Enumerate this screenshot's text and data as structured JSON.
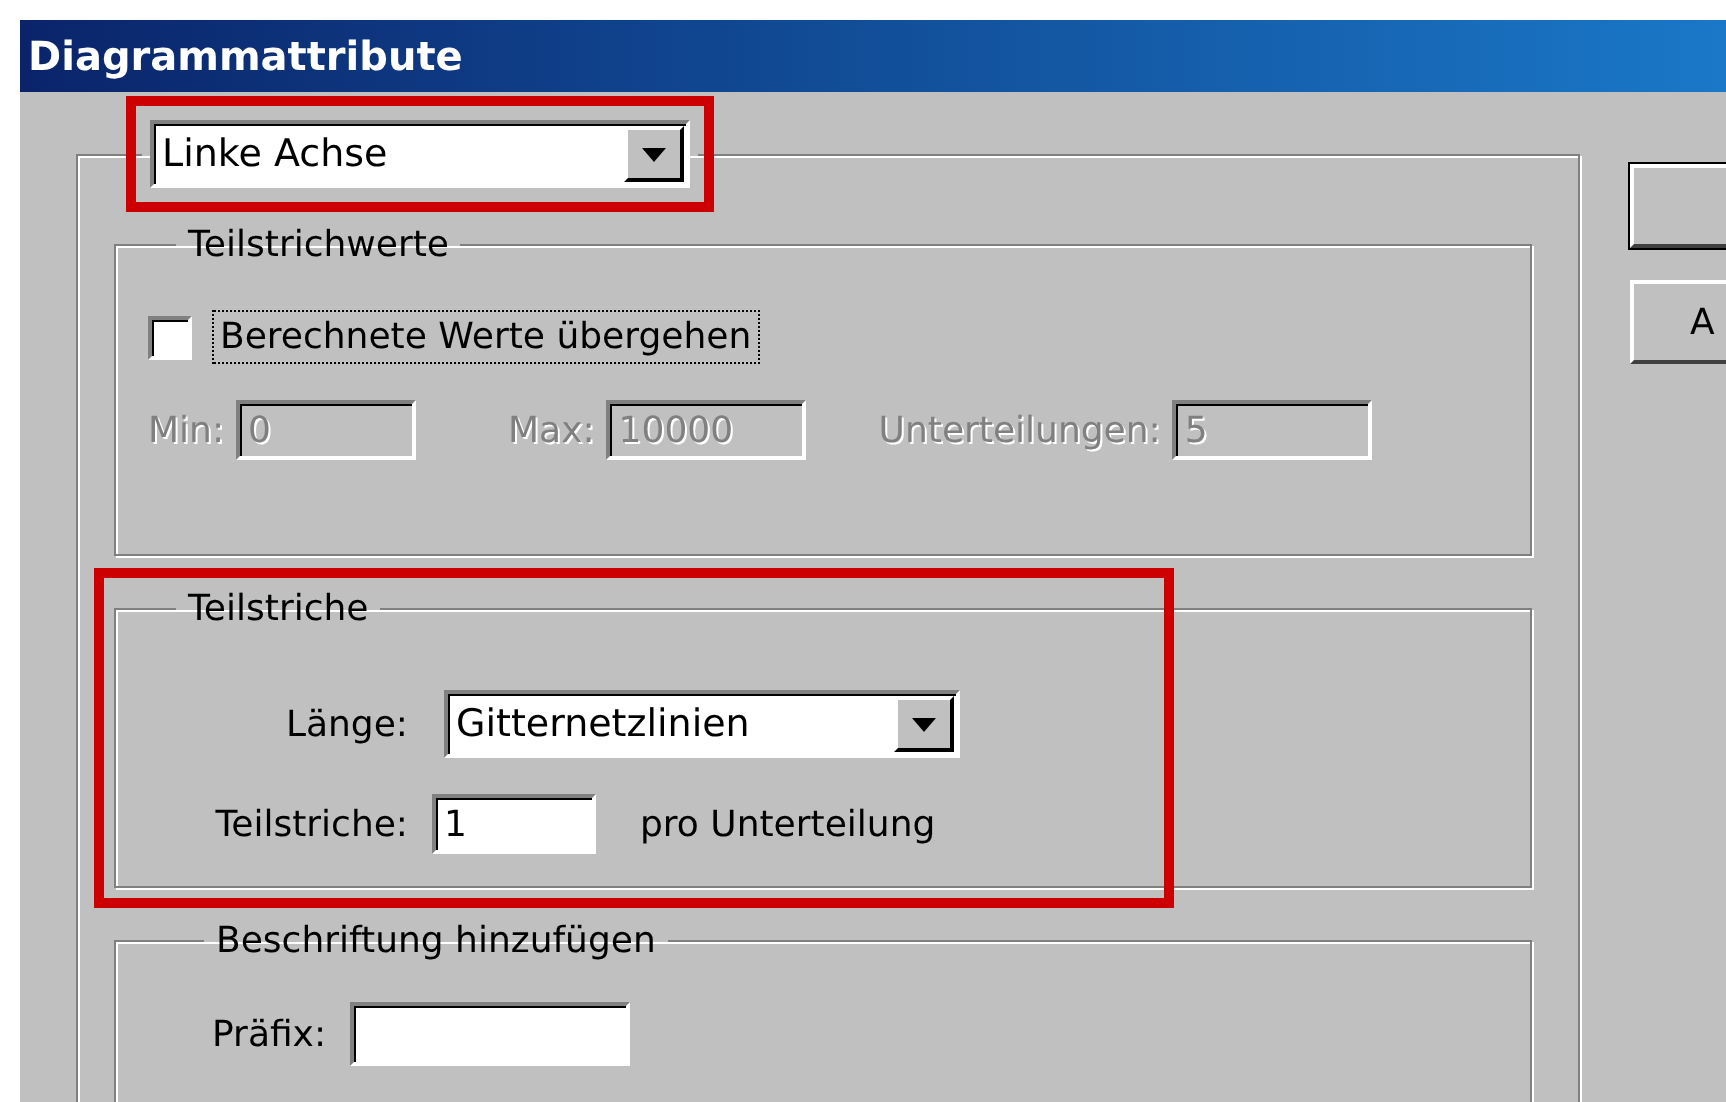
{
  "window": {
    "title": "Diagrammattribute"
  },
  "axis_select": {
    "value": "Linke Achse",
    "highlighted": true
  },
  "tick_values": {
    "title": "Teilstrichwerte",
    "override": {
      "label": "Berechnete Werte übergehen",
      "checked": false,
      "focused": true
    },
    "fields": [
      {
        "label": "Min:",
        "value": "0",
        "disabled": true
      },
      {
        "label": "Max:",
        "value": "10000",
        "disabled": true
      },
      {
        "label": "Unterteilungen:",
        "value": "5",
        "disabled": true
      }
    ]
  },
  "ticks": {
    "title": "Teilstriche",
    "highlighted": true,
    "length": {
      "label": "Länge:",
      "value": "Gitternetzlinien"
    },
    "count": {
      "label": "Teilstriche:",
      "value": "1",
      "suffix": "pro Unterteilung"
    }
  },
  "labels": {
    "title": "Beschriftung hinzufügen",
    "prefix": {
      "label": "Präfix:"
    }
  },
  "buttons": [
    {
      "default": true
    },
    {
      "label": "A",
      "default": false
    }
  ]
}
